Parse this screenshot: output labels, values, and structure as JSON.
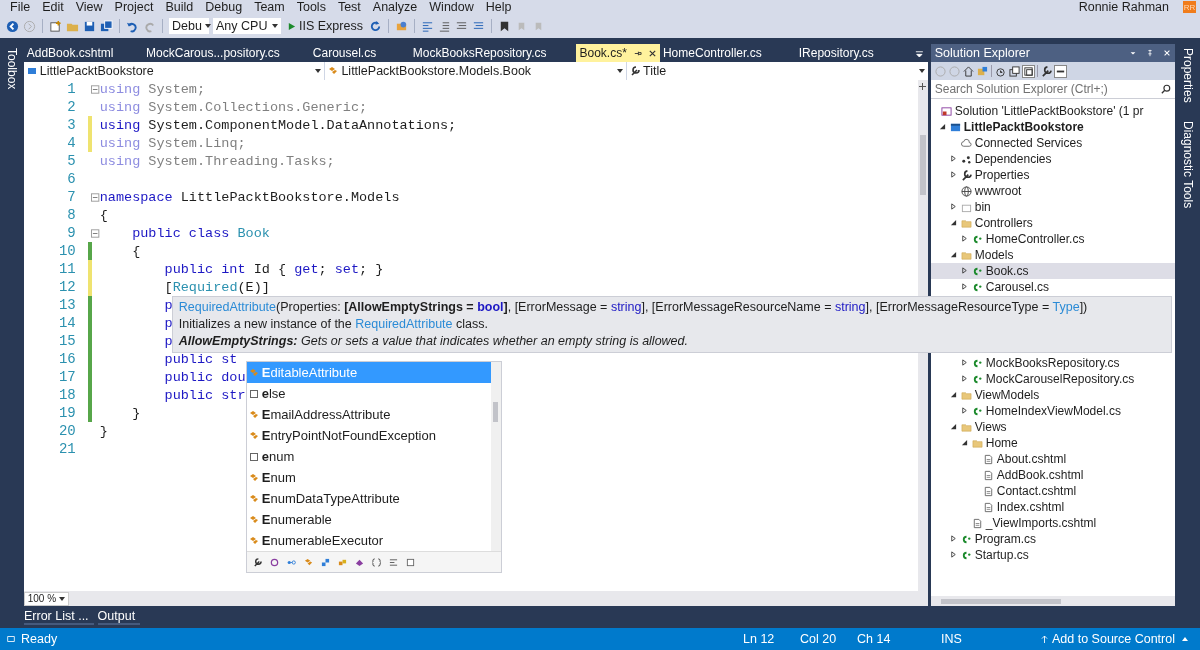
{
  "menu": [
    "File",
    "Edit",
    "View",
    "Project",
    "Build",
    "Debug",
    "Team",
    "Tools",
    "Test",
    "Analyze",
    "Window",
    "Help"
  ],
  "user": {
    "name": "Ronnie Rahman",
    "initials": "RR"
  },
  "toolbar": {
    "configuration": "Debu",
    "platform": "Any CPU",
    "run": "IIS Express"
  },
  "side_left": [
    "Toolbox"
  ],
  "side_right": [
    "Properties",
    "Diagnostic Tools"
  ],
  "tabs": [
    {
      "label": "AddBook.cshtml",
      "selected": false
    },
    {
      "label": "MockCarous...pository.cs",
      "selected": false
    },
    {
      "label": "Carousel.cs",
      "selected": false
    },
    {
      "label": "MockBooksRepository.cs",
      "selected": false
    },
    {
      "label": "Book.cs*",
      "selected": true
    },
    {
      "label": "HomeController.cs",
      "selected": false
    },
    {
      "label": "IRepository.cs",
      "selected": false
    }
  ],
  "nav": [
    {
      "label": "LittlePacktBookstore",
      "kind": "project"
    },
    {
      "label": "LittlePacktBookstore.Models.Book",
      "kind": "class"
    },
    {
      "label": "Title",
      "kind": "property"
    }
  ],
  "code": [
    {
      "number": "1",
      "unsaved": false,
      "saved": false,
      "fold": true,
      "segments": [
        {
          "text": "using",
          "kind": "dimkw"
        },
        {
          "text": " System;",
          "kind": "dim"
        }
      ]
    },
    {
      "number": "2",
      "unsaved": false,
      "saved": false,
      "fold": false,
      "segments": [
        {
          "text": "using",
          "kind": "dimkw"
        },
        {
          "text": " System.Collections.Generic;",
          "kind": "dim"
        }
      ]
    },
    {
      "number": "3",
      "unsaved": true,
      "saved": false,
      "fold": false,
      "segments": [
        {
          "text": "using",
          "kind": "kw"
        },
        {
          "text": " System.ComponentModel.DataAnnotations;",
          "kind": "plain"
        }
      ]
    },
    {
      "number": "4",
      "unsaved": true,
      "saved": false,
      "fold": false,
      "segments": [
        {
          "text": "using",
          "kind": "dimkw"
        },
        {
          "text": " System.Linq;",
          "kind": "dim"
        }
      ]
    },
    {
      "number": "5",
      "unsaved": false,
      "saved": false,
      "fold": false,
      "segments": [
        {
          "text": "using",
          "kind": "dimkw"
        },
        {
          "text": " System.Threading.Tasks;",
          "kind": "dim"
        }
      ]
    },
    {
      "number": "6",
      "unsaved": false,
      "saved": false,
      "fold": false
    },
    {
      "number": "7",
      "unsaved": false,
      "saved": false,
      "fold": true,
      "segments": [
        {
          "text": "namespace",
          "kind": "kw"
        },
        {
          "text": " LittlePacktBookstore.Models",
          "kind": "plain"
        }
      ]
    },
    {
      "number": "8",
      "unsaved": false,
      "saved": false,
      "fold": false,
      "segments": [
        {
          "text": "{",
          "kind": "plain"
        }
      ]
    },
    {
      "number": "9",
      "unsaved": false,
      "saved": false,
      "fold": true,
      "segments": [
        {
          "text": "    public class ",
          "kind": "kw"
        },
        {
          "text": "Book",
          "kind": "type"
        }
      ]
    },
    {
      "number": "10",
      "unsaved": false,
      "saved": true,
      "fold": false,
      "segments": [
        {
          "text": "    {",
          "kind": "plain"
        }
      ]
    },
    {
      "number": "11",
      "unsaved": true,
      "saved": false,
      "fold": false,
      "segments": [
        {
          "text": "        public int",
          "kind": "kw"
        },
        {
          "text": " Id { ",
          "kind": "plain"
        },
        {
          "text": "get",
          "kind": "kw"
        },
        {
          "text": "; ",
          "kind": "plain"
        },
        {
          "text": "set",
          "kind": "kw"
        },
        {
          "text": "; }",
          "kind": "plain"
        }
      ]
    },
    {
      "number": "12",
      "unsaved": true,
      "saved": false,
      "fold": false,
      "segments": [
        {
          "text": "        [",
          "kind": "plain"
        },
        {
          "text": "Required",
          "kind": "type"
        },
        {
          "text": "(E)]",
          "kind": "plain"
        }
      ]
    },
    {
      "number": "13",
      "unsaved": false,
      "saved": true,
      "fold": false,
      "segments": [
        {
          "text": "        p",
          "kind": "kw"
        }
      ]
    },
    {
      "number": "14",
      "unsaved": false,
      "saved": true,
      "fold": false,
      "segments": [
        {
          "text": "        p",
          "kind": "kw"
        }
      ]
    },
    {
      "number": "15",
      "unsaved": false,
      "saved": true,
      "fold": false,
      "segments": [
        {
          "text": "        p",
          "kind": "kw"
        }
      ]
    },
    {
      "number": "16",
      "unsaved": false,
      "saved": true,
      "fold": false,
      "segments": [
        {
          "text": "        public st",
          "kind": "kw"
        }
      ]
    },
    {
      "number": "17",
      "unsaved": false,
      "saved": true,
      "fold": false,
      "segments": [
        {
          "text": "        public dou",
          "kind": "kw"
        }
      ]
    },
    {
      "number": "18",
      "unsaved": false,
      "saved": true,
      "fold": false,
      "segments": [
        {
          "text": "        public str",
          "kind": "kw"
        }
      ]
    },
    {
      "number": "19",
      "unsaved": false,
      "saved": true,
      "fold": false,
      "segments": [
        {
          "text": "    }",
          "kind": "plain"
        }
      ]
    },
    {
      "number": "20",
      "unsaved": false,
      "saved": false,
      "fold": false,
      "segments": [
        {
          "text": "}",
          "kind": "plain"
        }
      ]
    },
    {
      "number": "21",
      "unsaved": false,
      "saved": false,
      "fold": false
    }
  ],
  "tooltip": {
    "signature": [
      {
        "text": "RequiredAttribute",
        "kind": "type"
      },
      {
        "text": "(Properties: ",
        "kind": "plain"
      },
      {
        "text": "[AllowEmptyStrings = ",
        "kind": "bold"
      },
      {
        "text": "bool",
        "kind": "boldkw"
      },
      {
        "text": "]",
        "kind": "bold"
      },
      {
        "text": ", [ErrorMessage = ",
        "kind": "plain"
      },
      {
        "text": "string",
        "kind": "kw"
      },
      {
        "text": "], [ErrorMessageResourceName = ",
        "kind": "plain"
      },
      {
        "text": "string",
        "kind": "kw"
      },
      {
        "text": "], [ErrorMessageResourceType = ",
        "kind": "plain"
      },
      {
        "text": "Type",
        "kind": "type"
      },
      {
        "text": "])",
        "kind": "plain"
      }
    ],
    "summary": [
      {
        "text": "Initializes a new instance of the ",
        "kind": "plain"
      },
      {
        "text": "RequiredAttribute",
        "kind": "type"
      },
      {
        "text": " class.",
        "kind": "plain"
      }
    ],
    "parameter": "**AllowEmptyStrings:** Gets or sets a value that indicates whether an empty string is allowed."
  },
  "completion": [
    {
      "label": "**E**ditableAttribute",
      "kind": "class",
      "selected": true
    },
    {
      "label": "**e**lse",
      "kind": "keyword",
      "selected": false
    },
    {
      "label": "**E**mailAddressAttribute",
      "kind": "class",
      "selected": false
    },
    {
      "label": "**E**ntryPointNotFoundException",
      "kind": "class",
      "selected": false
    },
    {
      "label": "**e**num",
      "kind": "keyword",
      "selected": false
    },
    {
      "label": "**E**num",
      "kind": "class",
      "selected": false
    },
    {
      "label": "**E**numDataTypeAttribute",
      "kind": "class",
      "selected": false
    },
    {
      "label": "**E**numerable",
      "kind": "class",
      "selected": false
    },
    {
      "label": "**E**numerableExecutor",
      "kind": "class",
      "selected": false
    }
  ],
  "zoom": "100 %",
  "explorer": {
    "title": "Solution Explorer",
    "search": {
      "placeholder": "Search Solution Explorer (Ctrl+;)"
    },
    "tree": [
      {
        "label": "Solution 'LittlePacktBookstore' (1 pr",
        "kind": "solution",
        "selected": false,
        "children": [
          {
            "label": "LittlePacktBookstore",
            "kind": "project",
            "expanded": true,
            "selected": false,
            "children": [
              {
                "label": "Connected Services",
                "kind": "service",
                "selected": false
              },
              {
                "label": "Dependencies",
                "kind": "dependencies",
                "expanded": false,
                "selected": false
              },
              {
                "label": "Properties",
                "kind": "properties",
                "expanded": false,
                "selected": false
              },
              {
                "label": "wwwroot",
                "kind": "web",
                "selected": false
              },
              {
                "label": "bin",
                "kind": "box",
                "expanded": false,
                "selected": false
              },
              {
                "label": "Controllers",
                "kind": "folder",
                "expanded": true,
                "selected": false,
                "children": [
                  {
                    "label": "HomeController.cs",
                    "kind": "csharp",
                    "expanded": false,
                    "selected": false
                  }
                ]
              },
              {
                "label": "Models",
                "kind": "folder",
                "expanded": true,
                "selected": false,
                "children": [
                  {
                    "label": "Book.cs",
                    "kind": "csharp",
                    "expanded": false,
                    "selected": true
                  },
                  {
                    "label": "Carousel.cs",
                    "kind": "csharp",
                    "expanded": false,
                    "selected": false
                  },
                  {
                    "label": "MockBooksRepository.cs",
                    "kind": "csharp",
                    "expanded": false,
                    "selected": false
                  },
                  {
                    "label": "MockCarouselRepository.cs",
                    "kind": "csharp",
                    "expanded": false,
                    "selected": false
                  }
                ]
              },
              {
                "label": "ViewModels",
                "kind": "folder",
                "expanded": true,
                "selected": false,
                "children": [
                  {
                    "label": "HomeIndexViewModel.cs",
                    "kind": "csharp",
                    "expanded": false,
                    "selected": false
                  }
                ]
              },
              {
                "label": "Views",
                "kind": "folder",
                "expanded": true,
                "selected": false,
                "children": [
                  {
                    "label": "Home",
                    "kind": "folder",
                    "expanded": true,
                    "selected": false,
                    "children": [
                      {
                        "label": "About.cshtml",
                        "kind": "page",
                        "selected": false
                      },
                      {
                        "label": "AddBook.cshtml",
                        "kind": "page",
                        "selected": false
                      },
                      {
                        "label": "Contact.cshtml",
                        "kind": "page",
                        "selected": false
                      },
                      {
                        "label": "Index.cshtml",
                        "kind": "page",
                        "selected": false
                      }
                    ]
                  },
                  {
                    "label": "_ViewImports.cshtml",
                    "kind": "page",
                    "selected": false
                  }
                ]
              },
              {
                "label": "Program.cs",
                "kind": "csharp",
                "expanded": false,
                "selected": false
              },
              {
                "label": "Startup.cs",
                "kind": "csharp",
                "expanded": false,
                "selected": false
              }
            ]
          }
        ]
      }
    ]
  },
  "bottom_tabs": [
    "Error List ...",
    "Output"
  ],
  "status": {
    "message": "Ready",
    "line": "Ln 12",
    "col": "Col 20",
    "ch": "Ch 14",
    "mode": "INS",
    "source_control": "Add to Source Control"
  }
}
